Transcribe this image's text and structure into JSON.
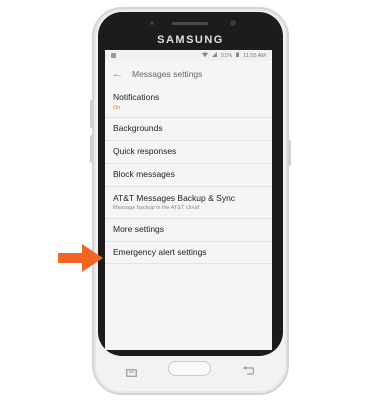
{
  "device": {
    "brand": "SAMSUNG"
  },
  "status_bar": {
    "battery": "51%",
    "time": "11:55 AM"
  },
  "header": {
    "title": "Messages settings"
  },
  "settings": [
    {
      "label": "Notifications",
      "sublabel": "On"
    },
    {
      "label": "Backgrounds"
    },
    {
      "label": "Quick responses"
    },
    {
      "label": "Block messages"
    },
    {
      "label": "AT&T Messages Backup & Sync",
      "sublabel": "Message backup in the AT&T cloud"
    },
    {
      "label": "More settings"
    },
    {
      "label": "Emergency alert settings"
    }
  ],
  "colors": {
    "accent": "#e8711c",
    "pointer": "#f26522"
  },
  "icons": {
    "back": "back-arrow-icon",
    "pointer": "arrow-right-icon",
    "recent": "recent-apps-icon",
    "nav_back": "nav-back-icon"
  }
}
